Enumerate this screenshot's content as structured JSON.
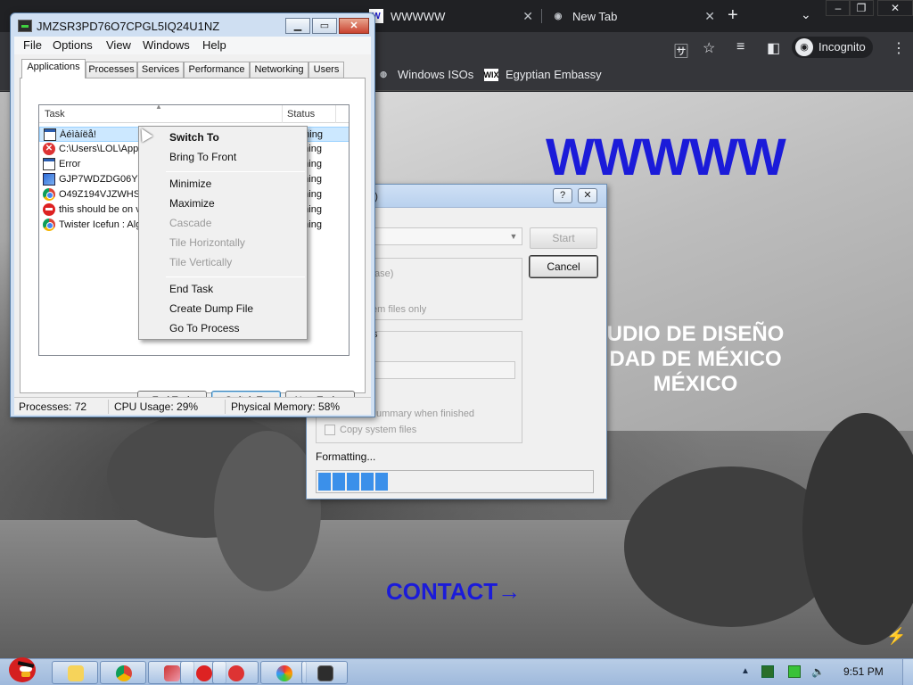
{
  "browser": {
    "tabs": [
      {
        "label": "WWWWW",
        "favicon": "W"
      },
      {
        "label": "New Tab",
        "favicon": "incognito-icon"
      }
    ],
    "incognito_label": "Incognito",
    "bookmarks": [
      {
        "label": "Windows ISOs"
      },
      {
        "label": "Egyptian Embassy",
        "favicon": "WIX"
      }
    ]
  },
  "site": {
    "title": "WWWWW",
    "studio_lines": [
      "UDIO DE DISEÑO",
      "DAD DE MÉXICO",
      "MÉXICO"
    ],
    "contact": "CONTACT→",
    "accent": "#1b1bd9"
  },
  "format_dialog": {
    "title_fragment": ")",
    "help": "?",
    "close": "✕",
    "start": "Start",
    "cancel": "Cancel",
    "text_ase": "ase)",
    "text_tem_files": "tem files only",
    "text_s": "s",
    "text_summary": "ummary when finished",
    "copy_system_files": "Copy system files",
    "formatting": "Formatting...",
    "progress_fraction": 0.25
  },
  "task_manager": {
    "title": "JMZSR3PD76O7CPGL5IQ24U1NZ",
    "menu": [
      "File",
      "Options",
      "View",
      "Windows",
      "Help"
    ],
    "tabs": [
      "Applications",
      "Processes",
      "Services",
      "Performance",
      "Networking",
      "Users"
    ],
    "columns": {
      "task": "Task",
      "status": "Status"
    },
    "rows": [
      {
        "task": "Áéìàíëå!",
        "status": "Running",
        "icon": "window-icon"
      },
      {
        "task": "C:\\Users\\LOL\\AppD",
        "status": "Running",
        "icon": "error-icon"
      },
      {
        "task": "Error",
        "status": "Running",
        "icon": "window-icon"
      },
      {
        "task": "GJP7WDZDG06YDE",
        "status": "Running",
        "icon": "app-icon"
      },
      {
        "task": "O49Z194VJZWHSV",
        "status": "Running",
        "icon": "chrome-icon"
      },
      {
        "task": "this should be on v",
        "status": "Running",
        "icon": "bird-icon"
      },
      {
        "task": "Twister Icefun : Alg",
        "status": "Running",
        "icon": "chrome-icon"
      }
    ],
    "buttons": {
      "end_task": "End Task",
      "switch_to": "Switch To",
      "new_task": "New Task..."
    },
    "status": {
      "processes": "Processes: 72",
      "cpu": "CPU Usage: 29%",
      "memory": "Physical Memory: 58%"
    }
  },
  "context_menu": {
    "items": [
      {
        "label": "Switch To",
        "bold": true,
        "disabled": false
      },
      {
        "label": "Bring To Front",
        "bold": false,
        "disabled": false
      },
      {
        "label": "Minimize",
        "bold": false,
        "disabled": false
      },
      {
        "label": "Maximize",
        "bold": false,
        "disabled": false
      },
      {
        "label": "Cascade",
        "bold": false,
        "disabled": true
      },
      {
        "label": "Tile Horizontally",
        "bold": false,
        "disabled": true
      },
      {
        "label": "Tile Vertically",
        "bold": false,
        "disabled": true
      },
      {
        "label": "End Task",
        "bold": false,
        "disabled": false
      },
      {
        "label": "Create Dump File",
        "bold": false,
        "disabled": false
      },
      {
        "label": "Go To Process",
        "bold": false,
        "disabled": false
      }
    ]
  },
  "taskbar": {
    "clock": "9:51 PM",
    "pinned": [
      "folder-icon",
      "chrome-icon",
      "app-icon",
      "bird-icon",
      "error-icon",
      "paint-icon",
      "task-manager-icon"
    ]
  }
}
